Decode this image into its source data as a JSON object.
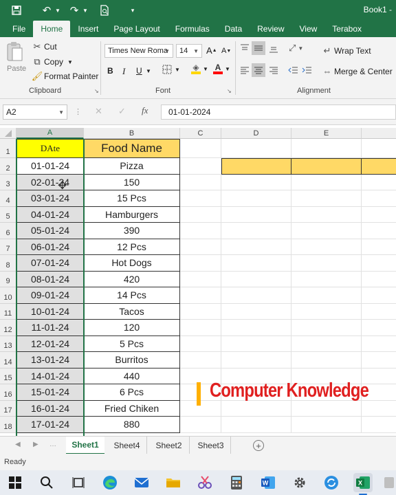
{
  "app": {
    "title": "Book1 -"
  },
  "colors": {
    "excel_green": "#217346",
    "header_yellow": "#ffff00",
    "orange": "#ffd966",
    "watermark_red": "#e02020"
  },
  "quick_access": {
    "save": "save-icon",
    "undo": "undo-icon",
    "redo": "redo-icon",
    "preview": "print-preview-icon",
    "customize": "customize-icon"
  },
  "tabs": [
    "File",
    "Home",
    "Insert",
    "Page Layout",
    "Formulas",
    "Data",
    "Review",
    "View",
    "Terabox"
  ],
  "ribbon": {
    "clipboard": {
      "paste": "Paste",
      "cut": "Cut",
      "copy": "Copy",
      "format_painter": "Format Painter",
      "label": "Clipboard"
    },
    "font": {
      "name": "Times New Roma",
      "size": "14",
      "bold": "B",
      "italic": "I",
      "underline": "U",
      "grow": "A",
      "shrink": "A",
      "label": "Font"
    },
    "alignment": {
      "wrap_text": "Wrap Text",
      "merge_center": "Merge & Center",
      "label": "Alignment"
    }
  },
  "formula_bar": {
    "name_box": "A2",
    "cancel": "✕",
    "enter": "✓",
    "fx": "fx",
    "value": "01-01-2024"
  },
  "columns": [
    "A",
    "B",
    "C",
    "D",
    "E",
    ""
  ],
  "rows": [
    {
      "num": "1",
      "a": "DAte",
      "b": "Food Name"
    },
    {
      "num": "2",
      "a": "01-01-24",
      "b": "Pizza"
    },
    {
      "num": "3",
      "a": "02-01-24",
      "b": "150"
    },
    {
      "num": "4",
      "a": "03-01-24",
      "b": "15 Pcs"
    },
    {
      "num": "5",
      "a": "04-01-24",
      "b": "Hamburgers"
    },
    {
      "num": "6",
      "a": "05-01-24",
      "b": "390"
    },
    {
      "num": "7",
      "a": "06-01-24",
      "b": "12 Pcs"
    },
    {
      "num": "8",
      "a": "07-01-24",
      "b": "Hot Dogs"
    },
    {
      "num": "9",
      "a": "08-01-24",
      "b": "420"
    },
    {
      "num": "10",
      "a": "09-01-24",
      "b": "14 Pcs"
    },
    {
      "num": "11",
      "a": "10-01-24",
      "b": "Tacos"
    },
    {
      "num": "12",
      "a": "11-01-24",
      "b": "120"
    },
    {
      "num": "13",
      "a": "12-01-24",
      "b": "5 Pcs"
    },
    {
      "num": "14",
      "a": "13-01-24",
      "b": "Burritos"
    },
    {
      "num": "15",
      "a": "14-01-24",
      "b": "440"
    },
    {
      "num": "16",
      "a": "15-01-24",
      "b": "6 Pcs"
    },
    {
      "num": "17",
      "a": "16-01-24",
      "b": "Fried Chiken"
    },
    {
      "num": "18",
      "a": "17-01-24",
      "b": "880"
    }
  ],
  "watermark": "Computer Knowledge",
  "sheets": [
    "Sheet1",
    "Sheet4",
    "Sheet2",
    "Sheet3"
  ],
  "add_sheet": "+",
  "status": "Ready"
}
